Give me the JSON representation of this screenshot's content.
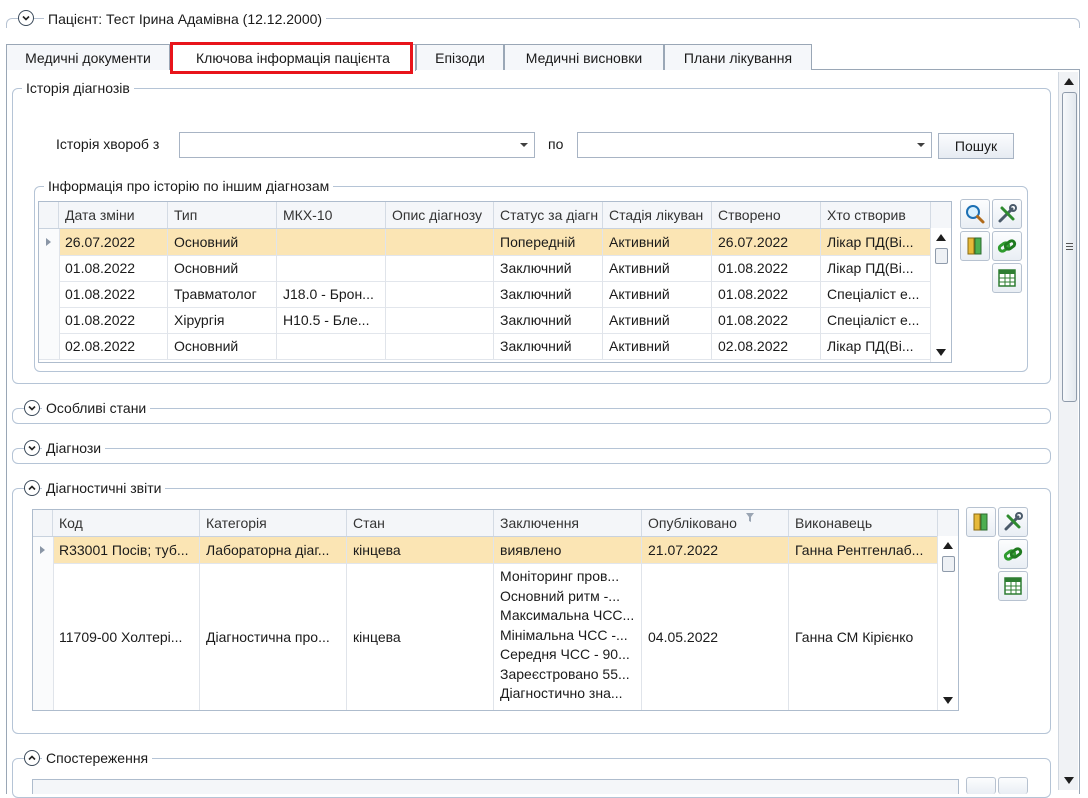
{
  "patient": {
    "title": "Пацієнт: Тест Ірина Адамівна (12.12.2000)"
  },
  "tabs": [
    {
      "label": "Медичні документи"
    },
    {
      "label": "Ключова інформація пацієнта"
    },
    {
      "label": "Епізоди"
    },
    {
      "label": "Медичні висновки"
    },
    {
      "label": "Плани лікування"
    }
  ],
  "history": {
    "title": "Історія діагнозів",
    "from_label": "Історія хвороб з",
    "to_label": "по",
    "from_value": "",
    "to_value": "",
    "search_label": "Пошук",
    "subgroup_title": "Інформація про історію по іншим діагнозам",
    "columns": [
      "Дата зміни",
      "Тип",
      "МКХ-10",
      "Опис діагнозу",
      "Статус за діагн",
      "Стадія лікуван",
      "Створено",
      "Хто створив"
    ],
    "rows": [
      [
        "26.07.2022",
        "Основний",
        "",
        "",
        "Попередній",
        "Активний",
        "26.07.2022",
        "Лікар ПД(Ві..."
      ],
      [
        "01.08.2022",
        "Основний",
        "",
        "",
        "Заключний",
        "Активний",
        "01.08.2022",
        "Лікар ПД(Ві..."
      ],
      [
        "01.08.2022",
        "Травматолог",
        "J18.0 - Брон...",
        "",
        "Заключний",
        "Активний",
        "01.08.2022",
        "Спеціаліст е..."
      ],
      [
        "01.08.2022",
        "Хірургія",
        "H10.5 - Бле...",
        "",
        "Заключний",
        "Активний",
        "01.08.2022",
        "Спеціаліст е..."
      ],
      [
        "02.08.2022",
        "Основний",
        "",
        "",
        "Заключний",
        "Активний",
        "02.08.2022",
        "Лікар ПД(Ві..."
      ]
    ]
  },
  "sections": {
    "special": "Особливі стани",
    "diagnoses": "Діагнози",
    "reports": "Діагностичні звіти",
    "observations": "Спостереження"
  },
  "reports": {
    "columns": [
      "Код",
      "Категорія",
      "Стан",
      "Заключення",
      "Опубліковано",
      "Виконавець"
    ],
    "row1": [
      "R33001 Посів; туб...",
      "Лабораторна діаг...",
      "кінцева",
      "виявлено",
      "21.07.2022",
      "Ганна Рентгенлаб..."
    ],
    "row2": {
      "code": "11709-00 Холтері...",
      "category": "Діагностична про...",
      "state": "кінцева",
      "conclusion": [
        "Моніторинг пров...",
        "Основний ритм -...",
        "Максимальна ЧСС...",
        "Мінімальна ЧСС -...",
        "Середня ЧСС - 90...",
        "Зареєстровано 55...",
        "Діагностично зна..."
      ],
      "published": "04.05.2022",
      "performer": "Ганна СМ Кірієнко"
    }
  }
}
